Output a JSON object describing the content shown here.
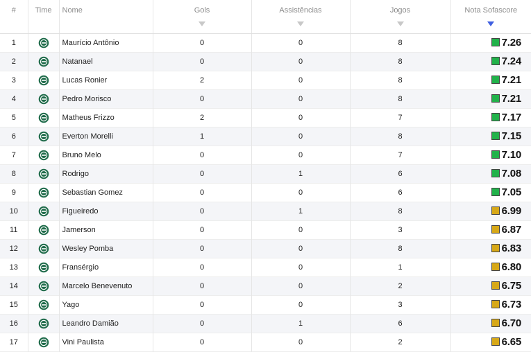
{
  "columns": {
    "pos": "#",
    "team": "Time",
    "name": "Nome",
    "goals": "Gols",
    "assists": "Assistências",
    "games": "Jogos",
    "rating": "Nota Sofascore"
  },
  "colors": {
    "rating_high": "#21b24a",
    "rating_mid": "#d7a817",
    "sort_active": "#3f5fe0",
    "team_crest": "#1f6b4a"
  },
  "team_icon": "team-crest-icon",
  "rows": [
    {
      "pos": "1",
      "name": "Maurício Antônio",
      "goals": "0",
      "assists": "0",
      "games": "8",
      "rating": "7.26",
      "level": "high"
    },
    {
      "pos": "2",
      "name": "Natanael",
      "goals": "0",
      "assists": "0",
      "games": "8",
      "rating": "7.24",
      "level": "high"
    },
    {
      "pos": "3",
      "name": "Lucas Ronier",
      "goals": "2",
      "assists": "0",
      "games": "8",
      "rating": "7.21",
      "level": "high"
    },
    {
      "pos": "4",
      "name": "Pedro Morisco",
      "goals": "0",
      "assists": "0",
      "games": "8",
      "rating": "7.21",
      "level": "high"
    },
    {
      "pos": "5",
      "name": "Matheus Frizzo",
      "goals": "2",
      "assists": "0",
      "games": "7",
      "rating": "7.17",
      "level": "high"
    },
    {
      "pos": "6",
      "name": "Everton Morelli",
      "goals": "1",
      "assists": "0",
      "games": "8",
      "rating": "7.15",
      "level": "high"
    },
    {
      "pos": "7",
      "name": "Bruno Melo",
      "goals": "0",
      "assists": "0",
      "games": "7",
      "rating": "7.10",
      "level": "high"
    },
    {
      "pos": "8",
      "name": "Rodrigo",
      "goals": "0",
      "assists": "1",
      "games": "6",
      "rating": "7.08",
      "level": "high"
    },
    {
      "pos": "9",
      "name": "Sebastian Gomez",
      "goals": "0",
      "assists": "0",
      "games": "6",
      "rating": "7.05",
      "level": "high"
    },
    {
      "pos": "10",
      "name": "Figueiredo",
      "goals": "0",
      "assists": "1",
      "games": "8",
      "rating": "6.99",
      "level": "mid"
    },
    {
      "pos": "11",
      "name": "Jamerson",
      "goals": "0",
      "assists": "0",
      "games": "3",
      "rating": "6.87",
      "level": "mid"
    },
    {
      "pos": "12",
      "name": "Wesley Pomba",
      "goals": "0",
      "assists": "0",
      "games": "8",
      "rating": "6.83",
      "level": "mid"
    },
    {
      "pos": "13",
      "name": "Fransérgio",
      "goals": "0",
      "assists": "0",
      "games": "1",
      "rating": "6.80",
      "level": "mid"
    },
    {
      "pos": "14",
      "name": "Marcelo Benevenuto",
      "goals": "0",
      "assists": "0",
      "games": "2",
      "rating": "6.75",
      "level": "mid"
    },
    {
      "pos": "15",
      "name": "Yago",
      "goals": "0",
      "assists": "0",
      "games": "3",
      "rating": "6.73",
      "level": "mid"
    },
    {
      "pos": "16",
      "name": "Leandro Damião",
      "goals": "0",
      "assists": "1",
      "games": "6",
      "rating": "6.70",
      "level": "mid"
    },
    {
      "pos": "17",
      "name": "Vini Paulista",
      "goals": "0",
      "assists": "0",
      "games": "2",
      "rating": "6.65",
      "level": "mid"
    }
  ]
}
